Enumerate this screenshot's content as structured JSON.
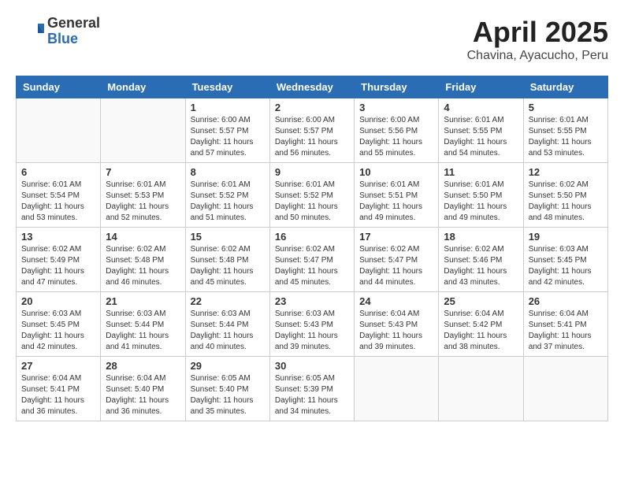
{
  "header": {
    "logo_general": "General",
    "logo_blue": "Blue",
    "month_title": "April 2025",
    "location": "Chavina, Ayacucho, Peru"
  },
  "weekdays": [
    "Sunday",
    "Monday",
    "Tuesday",
    "Wednesday",
    "Thursday",
    "Friday",
    "Saturday"
  ],
  "weeks": [
    [
      {
        "day": "",
        "info": ""
      },
      {
        "day": "",
        "info": ""
      },
      {
        "day": "1",
        "info": "Sunrise: 6:00 AM\nSunset: 5:57 PM\nDaylight: 11 hours and 57 minutes."
      },
      {
        "day": "2",
        "info": "Sunrise: 6:00 AM\nSunset: 5:57 PM\nDaylight: 11 hours and 56 minutes."
      },
      {
        "day": "3",
        "info": "Sunrise: 6:00 AM\nSunset: 5:56 PM\nDaylight: 11 hours and 55 minutes."
      },
      {
        "day": "4",
        "info": "Sunrise: 6:01 AM\nSunset: 5:55 PM\nDaylight: 11 hours and 54 minutes."
      },
      {
        "day": "5",
        "info": "Sunrise: 6:01 AM\nSunset: 5:55 PM\nDaylight: 11 hours and 53 minutes."
      }
    ],
    [
      {
        "day": "6",
        "info": "Sunrise: 6:01 AM\nSunset: 5:54 PM\nDaylight: 11 hours and 53 minutes."
      },
      {
        "day": "7",
        "info": "Sunrise: 6:01 AM\nSunset: 5:53 PM\nDaylight: 11 hours and 52 minutes."
      },
      {
        "day": "8",
        "info": "Sunrise: 6:01 AM\nSunset: 5:52 PM\nDaylight: 11 hours and 51 minutes."
      },
      {
        "day": "9",
        "info": "Sunrise: 6:01 AM\nSunset: 5:52 PM\nDaylight: 11 hours and 50 minutes."
      },
      {
        "day": "10",
        "info": "Sunrise: 6:01 AM\nSunset: 5:51 PM\nDaylight: 11 hours and 49 minutes."
      },
      {
        "day": "11",
        "info": "Sunrise: 6:01 AM\nSunset: 5:50 PM\nDaylight: 11 hours and 49 minutes."
      },
      {
        "day": "12",
        "info": "Sunrise: 6:02 AM\nSunset: 5:50 PM\nDaylight: 11 hours and 48 minutes."
      }
    ],
    [
      {
        "day": "13",
        "info": "Sunrise: 6:02 AM\nSunset: 5:49 PM\nDaylight: 11 hours and 47 minutes."
      },
      {
        "day": "14",
        "info": "Sunrise: 6:02 AM\nSunset: 5:48 PM\nDaylight: 11 hours and 46 minutes."
      },
      {
        "day": "15",
        "info": "Sunrise: 6:02 AM\nSunset: 5:48 PM\nDaylight: 11 hours and 45 minutes."
      },
      {
        "day": "16",
        "info": "Sunrise: 6:02 AM\nSunset: 5:47 PM\nDaylight: 11 hours and 45 minutes."
      },
      {
        "day": "17",
        "info": "Sunrise: 6:02 AM\nSunset: 5:47 PM\nDaylight: 11 hours and 44 minutes."
      },
      {
        "day": "18",
        "info": "Sunrise: 6:02 AM\nSunset: 5:46 PM\nDaylight: 11 hours and 43 minutes."
      },
      {
        "day": "19",
        "info": "Sunrise: 6:03 AM\nSunset: 5:45 PM\nDaylight: 11 hours and 42 minutes."
      }
    ],
    [
      {
        "day": "20",
        "info": "Sunrise: 6:03 AM\nSunset: 5:45 PM\nDaylight: 11 hours and 42 minutes."
      },
      {
        "day": "21",
        "info": "Sunrise: 6:03 AM\nSunset: 5:44 PM\nDaylight: 11 hours and 41 minutes."
      },
      {
        "day": "22",
        "info": "Sunrise: 6:03 AM\nSunset: 5:44 PM\nDaylight: 11 hours and 40 minutes."
      },
      {
        "day": "23",
        "info": "Sunrise: 6:03 AM\nSunset: 5:43 PM\nDaylight: 11 hours and 39 minutes."
      },
      {
        "day": "24",
        "info": "Sunrise: 6:04 AM\nSunset: 5:43 PM\nDaylight: 11 hours and 39 minutes."
      },
      {
        "day": "25",
        "info": "Sunrise: 6:04 AM\nSunset: 5:42 PM\nDaylight: 11 hours and 38 minutes."
      },
      {
        "day": "26",
        "info": "Sunrise: 6:04 AM\nSunset: 5:41 PM\nDaylight: 11 hours and 37 minutes."
      }
    ],
    [
      {
        "day": "27",
        "info": "Sunrise: 6:04 AM\nSunset: 5:41 PM\nDaylight: 11 hours and 36 minutes."
      },
      {
        "day": "28",
        "info": "Sunrise: 6:04 AM\nSunset: 5:40 PM\nDaylight: 11 hours and 36 minutes."
      },
      {
        "day": "29",
        "info": "Sunrise: 6:05 AM\nSunset: 5:40 PM\nDaylight: 11 hours and 35 minutes."
      },
      {
        "day": "30",
        "info": "Sunrise: 6:05 AM\nSunset: 5:39 PM\nDaylight: 11 hours and 34 minutes."
      },
      {
        "day": "",
        "info": ""
      },
      {
        "day": "",
        "info": ""
      },
      {
        "day": "",
        "info": ""
      }
    ]
  ]
}
